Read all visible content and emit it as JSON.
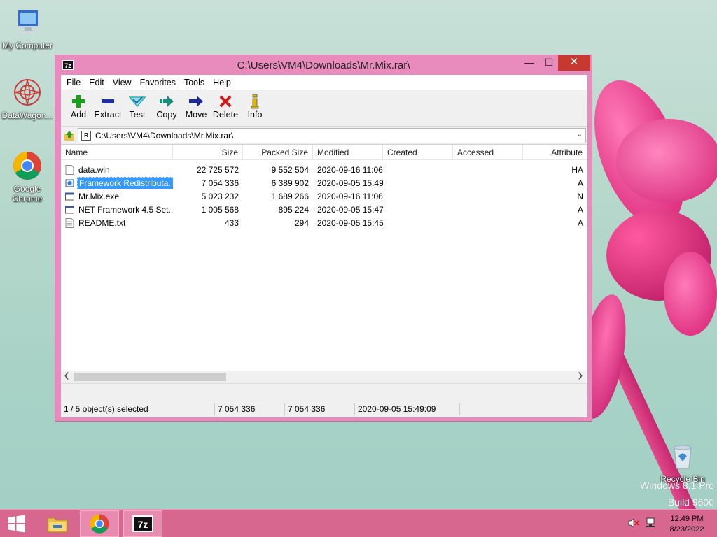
{
  "desktop": {
    "icons": [
      {
        "label": "My Computer"
      },
      {
        "label": "DataWagon..."
      },
      {
        "label": "Google Chrome"
      },
      {
        "label": "Recycle Bin"
      }
    ],
    "watermark_line1": "Windows 8.1 Pro",
    "watermark_line2": "Build 9600"
  },
  "window": {
    "title": "C:\\Users\\VM4\\Downloads\\Mr.Mix.rar\\",
    "app_icon_label": "7z",
    "min_glyph": "—",
    "max_glyph": "☐",
    "close_glyph": "✕"
  },
  "menu": [
    "File",
    "Edit",
    "View",
    "Favorites",
    "Tools",
    "Help"
  ],
  "toolbar": [
    {
      "label": "Add",
      "icon": "plus-icon",
      "color": "#18a018"
    },
    {
      "label": "Extract",
      "icon": "minus-icon",
      "color": "#1a2fa8"
    },
    {
      "label": "Test",
      "icon": "check-arrow-icon",
      "color": "#2ab0b0"
    },
    {
      "label": "Copy",
      "icon": "arrow-right-double-icon",
      "color": "#1a8c7a"
    },
    {
      "label": "Move",
      "icon": "arrow-right-icon",
      "color": "#1a2a90"
    },
    {
      "label": "Delete",
      "icon": "x-icon",
      "color": "#d01818"
    },
    {
      "label": "Info",
      "icon": "info-icon",
      "color": "#e0b800"
    }
  ],
  "address": {
    "path": "C:\\Users\\VM4\\Downloads\\Mr.Mix.rar\\"
  },
  "columns": {
    "name": "Name",
    "size": "Size",
    "packed": "Packed Size",
    "modified": "Modified",
    "created": "Created",
    "accessed": "Accessed",
    "attributes": "Attribute"
  },
  "files": [
    {
      "name": "data.win",
      "size": "22 725 572",
      "packed": "9 552 504",
      "modified": "2020-09-16 11:06",
      "attr": "HA",
      "icon": "document-icon"
    },
    {
      "name": "Framework Redistributa...",
      "size": "7 054 336",
      "packed": "6 389 902",
      "modified": "2020-09-05 15:49",
      "attr": "A",
      "icon": "installer-icon"
    },
    {
      "name": "Mr.Mix.exe",
      "size": "5 023 232",
      "packed": "1 689 266",
      "modified": "2020-09-16 11:06",
      "attr": "N",
      "icon": "application-icon"
    },
    {
      "name": "NET Framework 4.5 Set...",
      "size": "1 005 568",
      "packed": "895 224",
      "modified": "2020-09-05 15:47",
      "attr": "A",
      "icon": "application-icon"
    },
    {
      "name": "README.txt",
      "size": "433",
      "packed": "294",
      "modified": "2020-09-05 15:45",
      "attr": "A",
      "icon": "text-file-icon"
    }
  ],
  "status": {
    "selection": "1 / 5 object(s) selected",
    "size": "7 054 336",
    "packed": "7 054 336",
    "modified": "2020-09-05 15:49:09"
  },
  "taskbar": {
    "time": "12:49 PM",
    "date": "8/23/2022",
    "zip_label": "7z"
  }
}
